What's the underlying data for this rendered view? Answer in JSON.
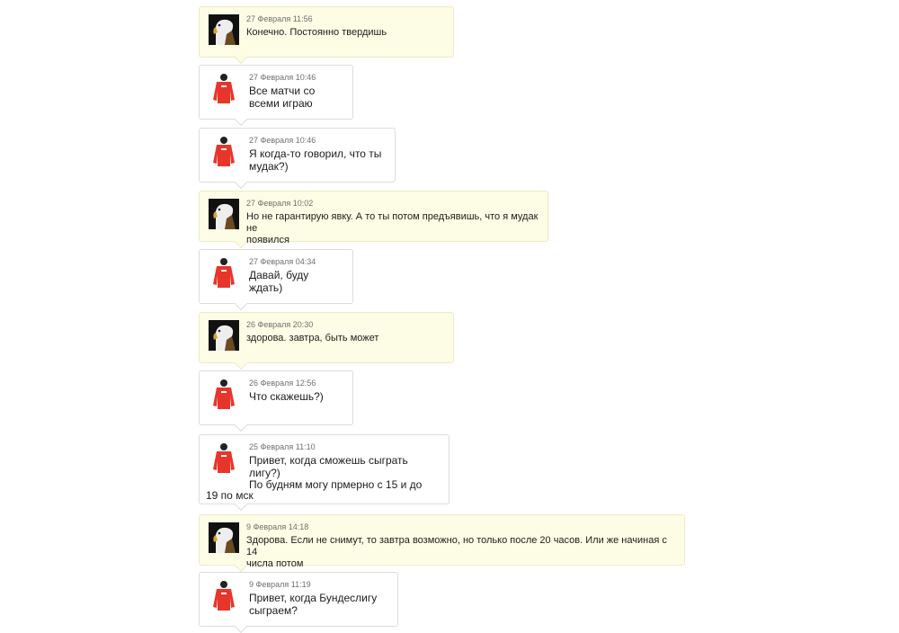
{
  "messages": [
    {
      "date": "27 Февраля 11:56",
      "text": "Конечно. Постоянно твердишь",
      "sender": "eagle"
    },
    {
      "date": "27 Февраля 10:46",
      "text": "Все матчи со\nвсеми играю",
      "sender": "red"
    },
    {
      "date": "27 Февраля 10:46",
      "text": "Я когда-то говорил, что ты\nмудак?)",
      "sender": "red"
    },
    {
      "date": "27 Февраля 10:02",
      "text": "Но не гарантирую явку. А то ты потом предъявишь, что я мудак не\nпоявился",
      "sender": "eagle"
    },
    {
      "date": "27 Февраля 04:34",
      "text": "Давай, буду\nждать)",
      "sender": "red"
    },
    {
      "date": "26 Февраля 20:30",
      "text": "здорова. завтра, быть может",
      "sender": "eagle"
    },
    {
      "date": "26 Февраля 12:56",
      "text": "Что скажешь?)",
      "sender": "red"
    },
    {
      "date": "25 Февраля 11:10",
      "text": "Привет, когда сможешь сыграть\nлигу?)\nПо будням могу прмерно с 15 и до",
      "text_tail": "19 по мск",
      "sender": "red"
    },
    {
      "date": "9 Февраля 14:18",
      "text": "Здорова. Если не снимут, то завтра возможно, но только после 20 часов. Или же начиная с 14\nчисла потом",
      "sender": "eagle"
    },
    {
      "date": "9 Февраля 11:19",
      "text": "Привет, когда Бундеслигу\nсыграем?",
      "sender": "red"
    }
  ],
  "icons": {
    "eagle": "eagle-avatar-icon",
    "red": "red-jersey-avatar-icon"
  },
  "colors": {
    "own_bubble": "#fdfde5",
    "other_bubble": "#ffffff",
    "jersey": "#e8352b"
  }
}
